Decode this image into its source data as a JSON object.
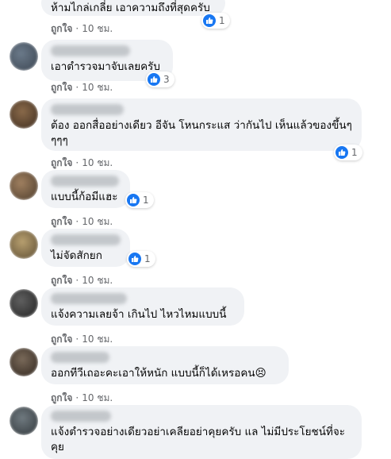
{
  "colors": {
    "like_blue": "#1877f2",
    "bubble_bg": "#f0f2f5",
    "meta_text": "#65676b"
  },
  "action_like_label": "ถูกใจ",
  "comments": [
    {
      "author": "",
      "text": "ห้ามไกล่เกลี่ย เอาความถึงที่สุดครับ",
      "time": "10 ชม.",
      "reactions": "1"
    },
    {
      "author": "",
      "text": "เอาตำรวจมาจับเลยครับ",
      "time": "10 ชม.",
      "reactions": "3"
    },
    {
      "author": "",
      "text": "ต้อง ออกสื่ออย่างเดียว อีจัน โหนกระแส ว่ากันไป เห็นแล้วของขึ้นๆๆๆๆ",
      "time": "10 ชม.",
      "reactions": "1"
    },
    {
      "author": "",
      "text": "แบบนี้ก้อมีแฮะ",
      "time": "10 ชม.",
      "reactions": "1"
    },
    {
      "author": "",
      "text": "ไม่จัดสักยก",
      "time": "10 ชม.",
      "reactions": "1"
    },
    {
      "author": "",
      "text": "แจ้งความเลยจ้า เกินไป ไหวไหมแบบนี้",
      "time": "10 ชม.",
      "reactions": ""
    },
    {
      "author": "",
      "text": "ออกทีวีเถอะคะเอาให้หนัก แบบนี้ก็ได้เหรอคน😣",
      "time": "10 ชม.",
      "reactions": ""
    },
    {
      "author": "",
      "text": "แจ้งตำรวจอย่างเดียวอย่าเคลียอย่าคุยครับ แล ไม่มีประโยชน์ที่จะคุย",
      "time": "",
      "reactions": ""
    }
  ]
}
